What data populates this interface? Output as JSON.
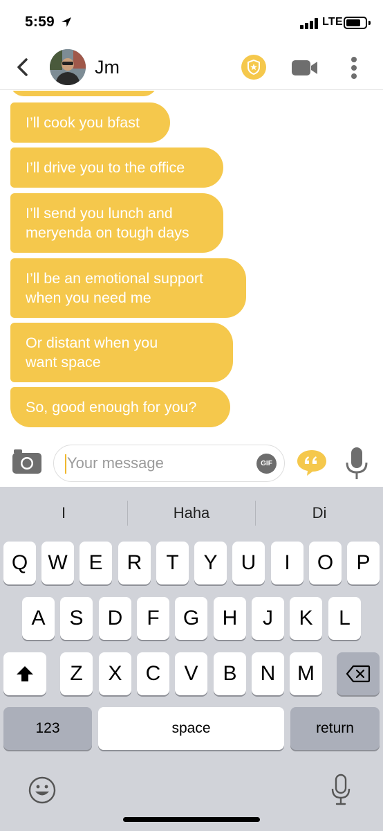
{
  "status_bar": {
    "time": "5:59",
    "network": "LTE",
    "icons": [
      "location-arrow-icon",
      "signal-bars-icon",
      "battery-icon"
    ]
  },
  "header": {
    "contact_name": "Jm",
    "icons": [
      "back-chevron-icon",
      "safety-shield-icon",
      "video-call-icon",
      "more-options-icon"
    ],
    "accent_color": "#f5c84c"
  },
  "messages": [
    {
      "text": "I’ll cook you bfast"
    },
    {
      "text": "I’ll drive you to the office"
    },
    {
      "text_lines": [
        "I’ll send you lunch and",
        "meryenda on tough days"
      ]
    },
    {
      "text_lines": [
        "I’ll be an emotional support",
        "when you need me"
      ]
    },
    {
      "text_lines": [
        "Or distant when you",
        "want space"
      ]
    },
    {
      "text": "So, good enough for you?"
    }
  ],
  "composer": {
    "placeholder": "Your message",
    "value": "",
    "gif_label": "GIF",
    "icons": [
      "camera-icon",
      "quote-icon",
      "microphone-icon"
    ]
  },
  "keyboard": {
    "suggestions": [
      "I",
      "Haha",
      "Di"
    ],
    "rows": [
      [
        "Q",
        "W",
        "E",
        "R",
        "T",
        "Y",
        "U",
        "I",
        "O",
        "P"
      ],
      [
        "A",
        "S",
        "D",
        "F",
        "G",
        "H",
        "J",
        "K",
        "L"
      ],
      [
        "Z",
        "X",
        "C",
        "V",
        "B",
        "N",
        "M"
      ]
    ],
    "numbers_label": "123",
    "space_label": "space",
    "return_label": "return",
    "icons": [
      "shift-icon",
      "backspace-icon",
      "emoji-icon",
      "dictation-icon"
    ]
  }
}
